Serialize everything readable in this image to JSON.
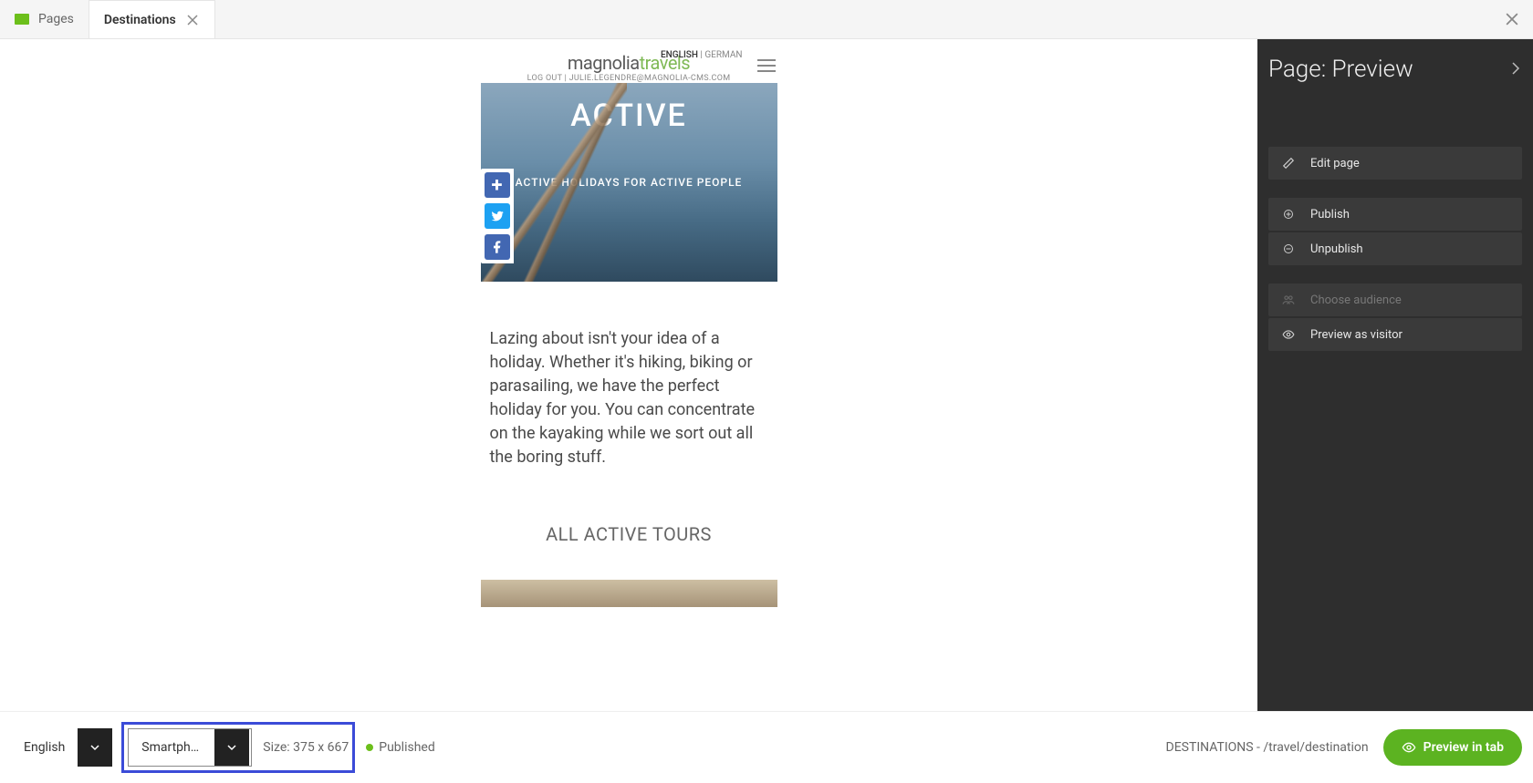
{
  "tabs": {
    "pages_label": "Pages",
    "active_label": "Destinations"
  },
  "panel": {
    "title": "Page: Preview",
    "edit": "Edit page",
    "publish": "Publish",
    "unpublish": "Unpublish",
    "audience": "Choose audience",
    "visitor": "Preview as visitor"
  },
  "statusbar": {
    "language": "English",
    "device": "Smartphone (portrait)",
    "size_label": "Size: 375 x 667",
    "status": "Published",
    "breadcrumb": "DESTINATIONS - /travel/destination",
    "preview_tab": "Preview in tab"
  },
  "preview": {
    "brand1": "magnolia",
    "brand2": "travels",
    "lang_en": "ENGLISH",
    "lang_sep": " | ",
    "lang_de": "GERMAN",
    "logout": "LOG OUT | JULIE.LEGENDRE@MAGNOLIA-CMS.COM",
    "hero_title": "ACTIVE",
    "hero_sub": "ACTIVE HOLIDAYS FOR ACTIVE PEOPLE",
    "body": "Lazing about isn't your idea of a holiday. Whether it's hiking, biking or parasailing, we have the perfect holiday for you. You can concentrate on the kayaking while we sort out all the boring stuff.",
    "section": "ALL ACTIVE TOURS"
  }
}
